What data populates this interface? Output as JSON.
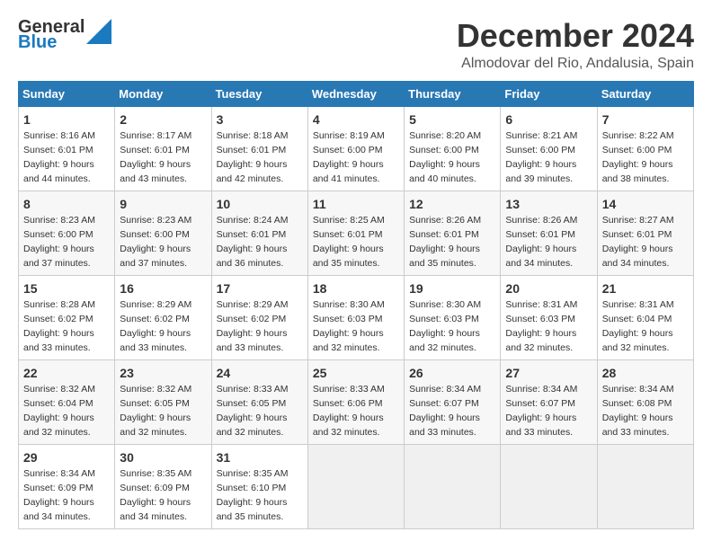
{
  "header": {
    "logo_line1": "General",
    "logo_line2": "Blue",
    "month": "December 2024",
    "location": "Almodovar del Rio, Andalusia, Spain"
  },
  "days_of_week": [
    "Sunday",
    "Monday",
    "Tuesday",
    "Wednesday",
    "Thursday",
    "Friday",
    "Saturday"
  ],
  "weeks": [
    [
      {
        "day": "1",
        "sunrise": "8:16 AM",
        "sunset": "6:01 PM",
        "daylight": "9 hours and 44 minutes."
      },
      {
        "day": "2",
        "sunrise": "8:17 AM",
        "sunset": "6:01 PM",
        "daylight": "9 hours and 43 minutes."
      },
      {
        "day": "3",
        "sunrise": "8:18 AM",
        "sunset": "6:01 PM",
        "daylight": "9 hours and 42 minutes."
      },
      {
        "day": "4",
        "sunrise": "8:19 AM",
        "sunset": "6:00 PM",
        "daylight": "9 hours and 41 minutes."
      },
      {
        "day": "5",
        "sunrise": "8:20 AM",
        "sunset": "6:00 PM",
        "daylight": "9 hours and 40 minutes."
      },
      {
        "day": "6",
        "sunrise": "8:21 AM",
        "sunset": "6:00 PM",
        "daylight": "9 hours and 39 minutes."
      },
      {
        "day": "7",
        "sunrise": "8:22 AM",
        "sunset": "6:00 PM",
        "daylight": "9 hours and 38 minutes."
      }
    ],
    [
      {
        "day": "8",
        "sunrise": "8:23 AM",
        "sunset": "6:00 PM",
        "daylight": "9 hours and 37 minutes."
      },
      {
        "day": "9",
        "sunrise": "8:23 AM",
        "sunset": "6:00 PM",
        "daylight": "9 hours and 37 minutes."
      },
      {
        "day": "10",
        "sunrise": "8:24 AM",
        "sunset": "6:01 PM",
        "daylight": "9 hours and 36 minutes."
      },
      {
        "day": "11",
        "sunrise": "8:25 AM",
        "sunset": "6:01 PM",
        "daylight": "9 hours and 35 minutes."
      },
      {
        "day": "12",
        "sunrise": "8:26 AM",
        "sunset": "6:01 PM",
        "daylight": "9 hours and 35 minutes."
      },
      {
        "day": "13",
        "sunrise": "8:26 AM",
        "sunset": "6:01 PM",
        "daylight": "9 hours and 34 minutes."
      },
      {
        "day": "14",
        "sunrise": "8:27 AM",
        "sunset": "6:01 PM",
        "daylight": "9 hours and 34 minutes."
      }
    ],
    [
      {
        "day": "15",
        "sunrise": "8:28 AM",
        "sunset": "6:02 PM",
        "daylight": "9 hours and 33 minutes."
      },
      {
        "day": "16",
        "sunrise": "8:29 AM",
        "sunset": "6:02 PM",
        "daylight": "9 hours and 33 minutes."
      },
      {
        "day": "17",
        "sunrise": "8:29 AM",
        "sunset": "6:02 PM",
        "daylight": "9 hours and 33 minutes."
      },
      {
        "day": "18",
        "sunrise": "8:30 AM",
        "sunset": "6:03 PM",
        "daylight": "9 hours and 32 minutes."
      },
      {
        "day": "19",
        "sunrise": "8:30 AM",
        "sunset": "6:03 PM",
        "daylight": "9 hours and 32 minutes."
      },
      {
        "day": "20",
        "sunrise": "8:31 AM",
        "sunset": "6:03 PM",
        "daylight": "9 hours and 32 minutes."
      },
      {
        "day": "21",
        "sunrise": "8:31 AM",
        "sunset": "6:04 PM",
        "daylight": "9 hours and 32 minutes."
      }
    ],
    [
      {
        "day": "22",
        "sunrise": "8:32 AM",
        "sunset": "6:04 PM",
        "daylight": "9 hours and 32 minutes."
      },
      {
        "day": "23",
        "sunrise": "8:32 AM",
        "sunset": "6:05 PM",
        "daylight": "9 hours and 32 minutes."
      },
      {
        "day": "24",
        "sunrise": "8:33 AM",
        "sunset": "6:05 PM",
        "daylight": "9 hours and 32 minutes."
      },
      {
        "day": "25",
        "sunrise": "8:33 AM",
        "sunset": "6:06 PM",
        "daylight": "9 hours and 32 minutes."
      },
      {
        "day": "26",
        "sunrise": "8:34 AM",
        "sunset": "6:07 PM",
        "daylight": "9 hours and 33 minutes."
      },
      {
        "day": "27",
        "sunrise": "8:34 AM",
        "sunset": "6:07 PM",
        "daylight": "9 hours and 33 minutes."
      },
      {
        "day": "28",
        "sunrise": "8:34 AM",
        "sunset": "6:08 PM",
        "daylight": "9 hours and 33 minutes."
      }
    ],
    [
      {
        "day": "29",
        "sunrise": "8:34 AM",
        "sunset": "6:09 PM",
        "daylight": "9 hours and 34 minutes."
      },
      {
        "day": "30",
        "sunrise": "8:35 AM",
        "sunset": "6:09 PM",
        "daylight": "9 hours and 34 minutes."
      },
      {
        "day": "31",
        "sunrise": "8:35 AM",
        "sunset": "6:10 PM",
        "daylight": "9 hours and 35 minutes."
      },
      null,
      null,
      null,
      null
    ]
  ],
  "labels": {
    "sunrise": "Sunrise:",
    "sunset": "Sunset:",
    "daylight": "Daylight hours"
  }
}
